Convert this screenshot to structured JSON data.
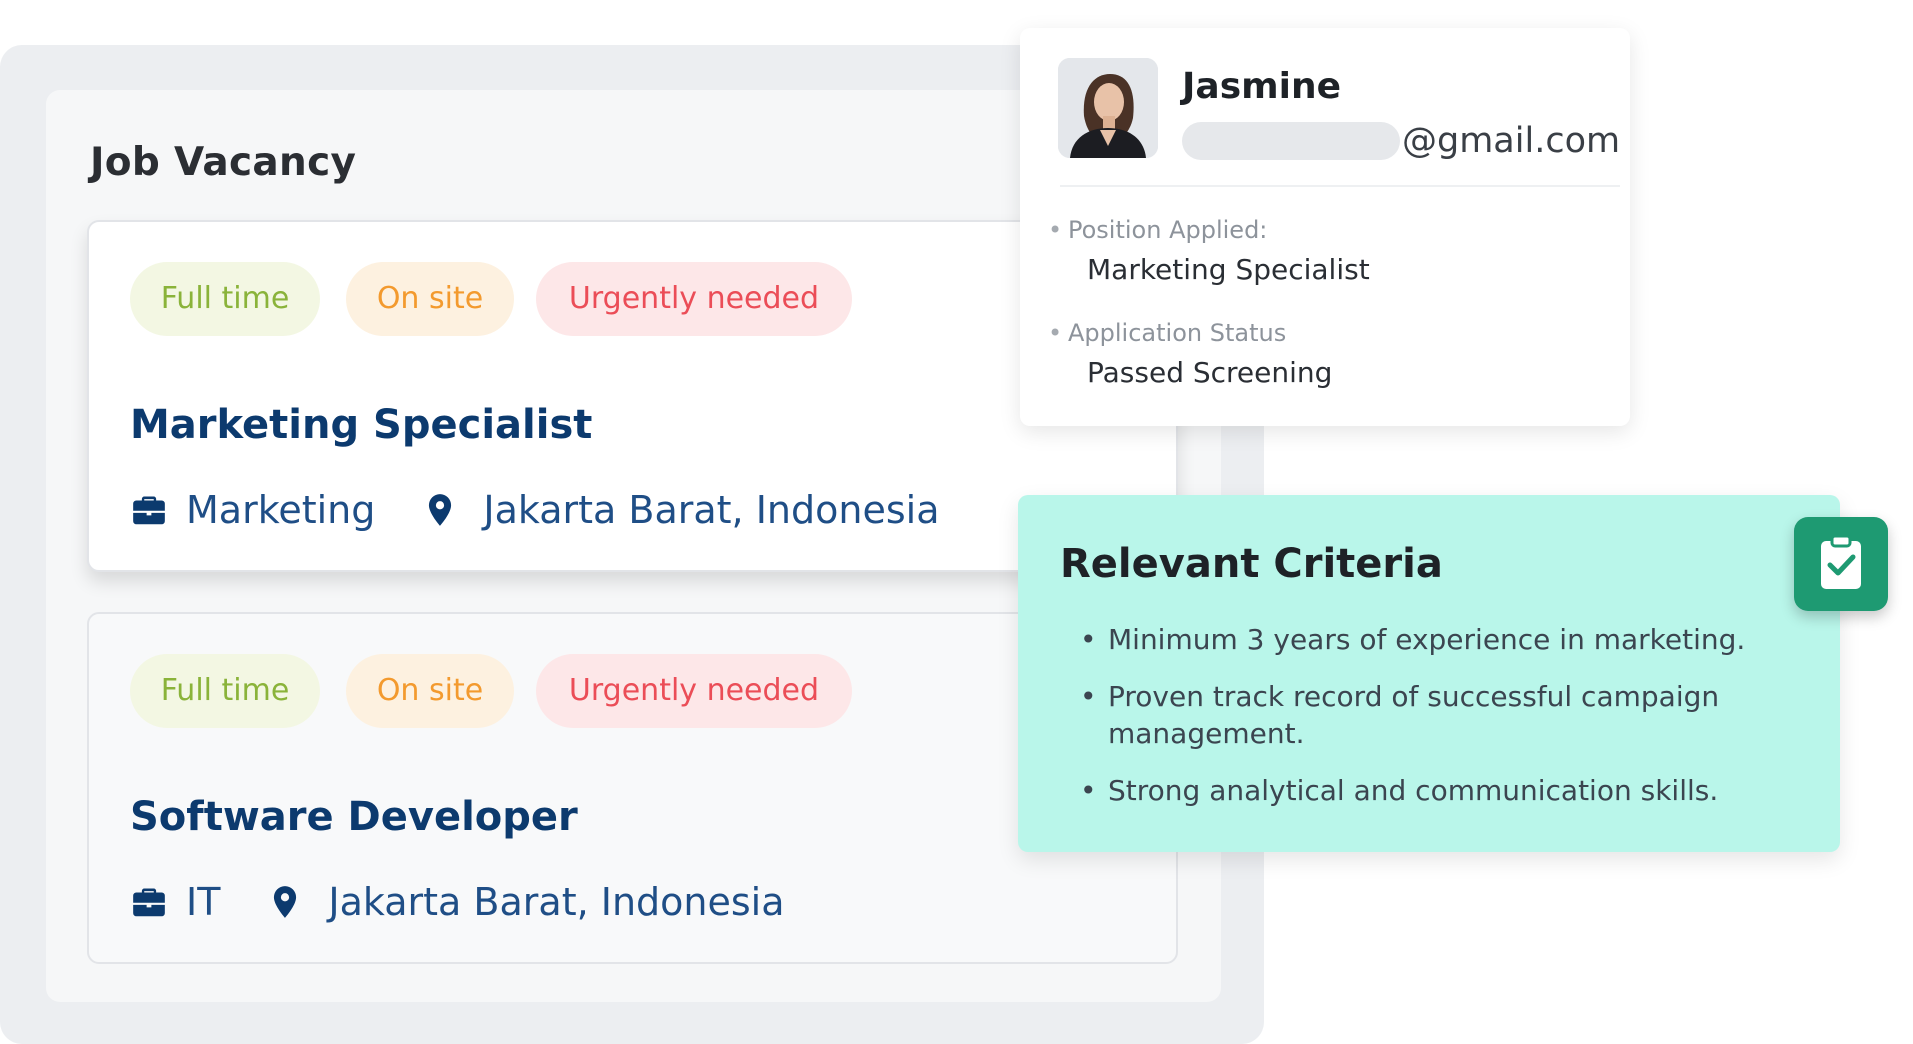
{
  "section_title": "Job Vacancy",
  "jobs": [
    {
      "tags": {
        "full_time": "Full time",
        "on_site": "On site",
        "urgent": "Urgently needed"
      },
      "title": "Marketing Specialist",
      "department": "Marketing",
      "location": "Jakarta Barat, Indonesia"
    },
    {
      "tags": {
        "full_time": "Full time",
        "on_site": "On site",
        "urgent": "Urgently needed"
      },
      "title": "Software Developer",
      "department": "IT",
      "location": "Jakarta Barat, Indonesia"
    }
  ],
  "candidate": {
    "name": "Jasmine",
    "email_domain": "@gmail.com",
    "position_label": "Position Applied:",
    "position_value": "Marketing Specialist",
    "status_label": "Application Status",
    "status_value": "Passed Screening"
  },
  "criteria": {
    "title": "Relevant Criteria",
    "items": [
      "Minimum 3 years of experience in marketing.",
      "Proven track record of successful campaign management.",
      "Strong analytical and communication skills."
    ]
  },
  "colors": {
    "job_title": "#0c3a6e",
    "tag_full_time": "#8ab33a",
    "tag_on_site": "#f39a2e",
    "tag_urgent": "#eb4d57",
    "criteria_bg": "#b9f6ea",
    "badge_bg": "#1e9a72"
  },
  "icons": {
    "department": "briefcase-icon",
    "location": "location-pin-icon",
    "criteria_badge": "clipboard-check-icon"
  }
}
